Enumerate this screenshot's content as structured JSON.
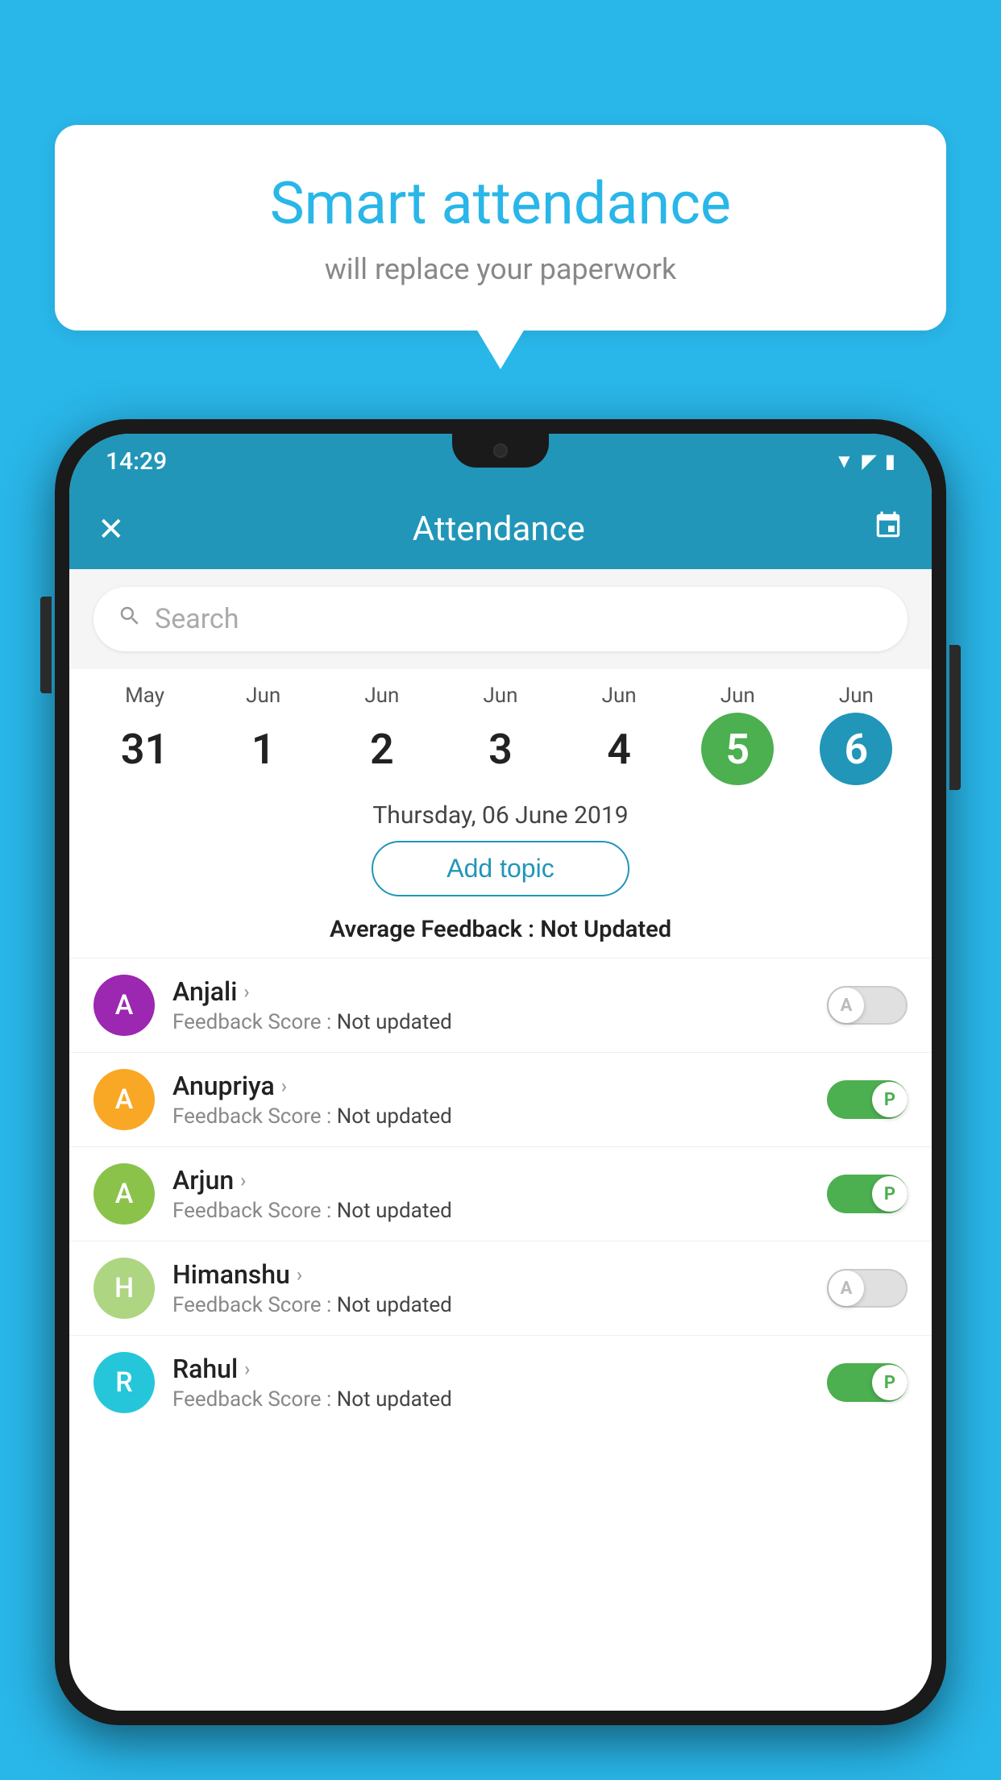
{
  "background_color": "#29b6e8",
  "bubble": {
    "title": "Smart attendance",
    "subtitle": "will replace your paperwork"
  },
  "status_bar": {
    "time": "14:29",
    "wifi": "▼",
    "signal": "▲",
    "battery": "▮"
  },
  "header": {
    "close_label": "✕",
    "title": "Attendance",
    "calendar_icon": "📅"
  },
  "search": {
    "placeholder": "Search"
  },
  "dates": [
    {
      "month": "May",
      "day": "31",
      "style": "normal"
    },
    {
      "month": "Jun",
      "day": "1",
      "style": "normal"
    },
    {
      "month": "Jun",
      "day": "2",
      "style": "normal"
    },
    {
      "month": "Jun",
      "day": "3",
      "style": "normal"
    },
    {
      "month": "Jun",
      "day": "4",
      "style": "normal"
    },
    {
      "month": "Jun",
      "day": "5",
      "style": "today"
    },
    {
      "month": "Jun",
      "day": "6",
      "style": "selected"
    }
  ],
  "selected_date_label": "Thursday, 06 June 2019",
  "add_topic_label": "Add topic",
  "avg_feedback_label": "Average Feedback :",
  "avg_feedback_value": "Not Updated",
  "students": [
    {
      "name": "Anjali",
      "avatar_letter": "A",
      "avatar_color": "#9c27b0",
      "feedback_label": "Feedback Score :",
      "feedback_value": "Not updated",
      "toggle": "off",
      "toggle_letter": "A"
    },
    {
      "name": "Anupriya",
      "avatar_letter": "A",
      "avatar_color": "#f9a825",
      "feedback_label": "Feedback Score :",
      "feedback_value": "Not updated",
      "toggle": "on",
      "toggle_letter": "P"
    },
    {
      "name": "Arjun",
      "avatar_letter": "A",
      "avatar_color": "#8bc34a",
      "feedback_label": "Feedback Score :",
      "feedback_value": "Not updated",
      "toggle": "on",
      "toggle_letter": "P"
    },
    {
      "name": "Himanshu",
      "avatar_letter": "H",
      "avatar_color": "#aed581",
      "feedback_label": "Feedback Score :",
      "feedback_value": "Not updated",
      "toggle": "off",
      "toggle_letter": "A"
    },
    {
      "name": "Rahul",
      "avatar_letter": "R",
      "avatar_color": "#26c6da",
      "feedback_label": "Feedback Score :",
      "feedback_value": "Not updated",
      "toggle": "on",
      "toggle_letter": "P"
    }
  ]
}
